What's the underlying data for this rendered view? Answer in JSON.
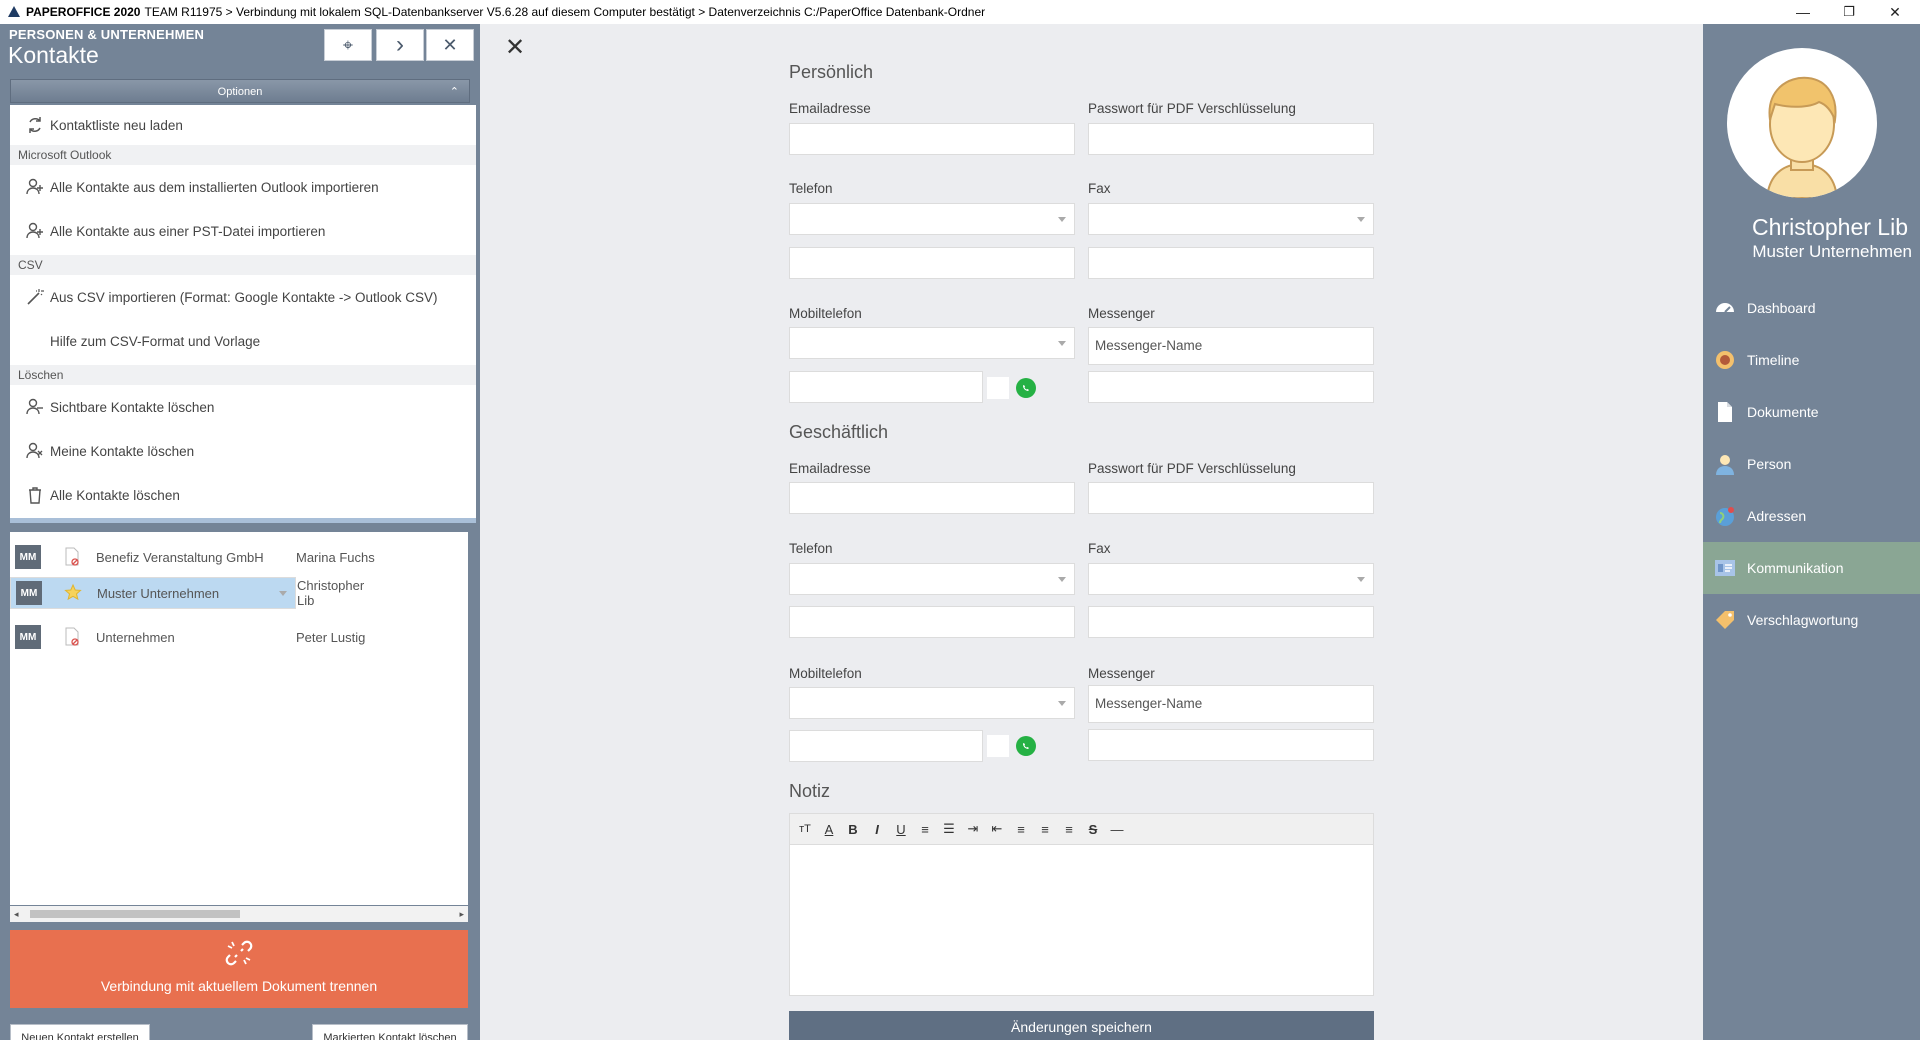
{
  "titlebar": {
    "app": "PAPEROFFICE 2020",
    "info": "TEAM R11975 > Verbindung mit lokalem SQL-Datenbankserver V5.6.28 auf diesem Computer bestätigt > Datenverzeichnis C:/PaperOffice Datenbank-Ordner",
    "minimize": "—",
    "restore": "❐",
    "close": "✕"
  },
  "left": {
    "subtitle": "PERSONEN & UNTERNEHMEN",
    "title": "Kontakte",
    "buttons": {
      "network": "⌖",
      "next": "›",
      "close": "✕"
    },
    "options_label": "Optionen",
    "options_caret": "⌃",
    "menu": {
      "reload": "Kontaktliste neu laden",
      "section_outlook": "Microsoft Outlook",
      "import_outlook": "Alle Kontakte aus dem installierten Outlook importieren",
      "import_pst": "Alle Kontakte aus einer PST-Datei importieren",
      "section_csv": "CSV",
      "import_csv": "Aus CSV importieren (Format: Google Kontakte -> Outlook CSV)",
      "csv_help": "Hilfe zum CSV-Format und Vorlage",
      "section_delete": "Löschen",
      "delete_visible": "Sichtbare Kontakte löschen",
      "delete_mine": "Meine Kontakte löschen",
      "delete_all": "Alle Kontakte löschen"
    },
    "contacts": [
      {
        "badge": "MM",
        "company": "Benefiz Veranstaltung GmbH",
        "person": "Marina Fuchs"
      },
      {
        "badge": "MM",
        "company": "Muster Unternehmen",
        "person": "Christopher Lib"
      },
      {
        "badge": "MM",
        "company": "Unternehmen",
        "person": "Peter Lustig"
      }
    ],
    "scroll_left": "◂",
    "scroll_right": "▸",
    "disconnect_label": "Verbindung mit aktuellem Dokument trennen",
    "new_contact": "Neuen Kontakt erstellen",
    "delete_marked": "Markierten Kontakt löschen"
  },
  "form": {
    "close": "✕",
    "personal": {
      "heading": "Persönlich",
      "email_label": "Emailadresse",
      "pdf_pw_label": "Passwort für PDF Verschlüsselung",
      "phone_label": "Telefon",
      "fax_label": "Fax",
      "mobile_label": "Mobiltelefon",
      "messenger_label": "Messenger",
      "messenger_value": "Messenger-Name"
    },
    "business": {
      "heading": "Geschäftlich",
      "email_label": "Emailadresse",
      "pdf_pw_label": "Passwort für PDF Verschlüsselung",
      "phone_label": "Telefon",
      "fax_label": "Fax",
      "mobile_label": "Mobiltelefon",
      "messenger_label": "Messenger",
      "messenger_value": "Messenger-Name"
    },
    "note_heading": "Notiz",
    "toolbar": [
      "тT",
      "A",
      "B",
      "I",
      "U",
      "≡",
      "☰",
      "⇥",
      "⇤",
      "≡",
      "≡",
      "≡",
      "S",
      "—"
    ],
    "save": "Änderungen speichern"
  },
  "right": {
    "name": "Christopher Lib",
    "company": "Muster Unternehmen",
    "nav": [
      "Dashboard",
      "Timeline",
      "Dokumente",
      "Person",
      "Adressen",
      "Kommunikation",
      "Verschlagwortung"
    ]
  }
}
